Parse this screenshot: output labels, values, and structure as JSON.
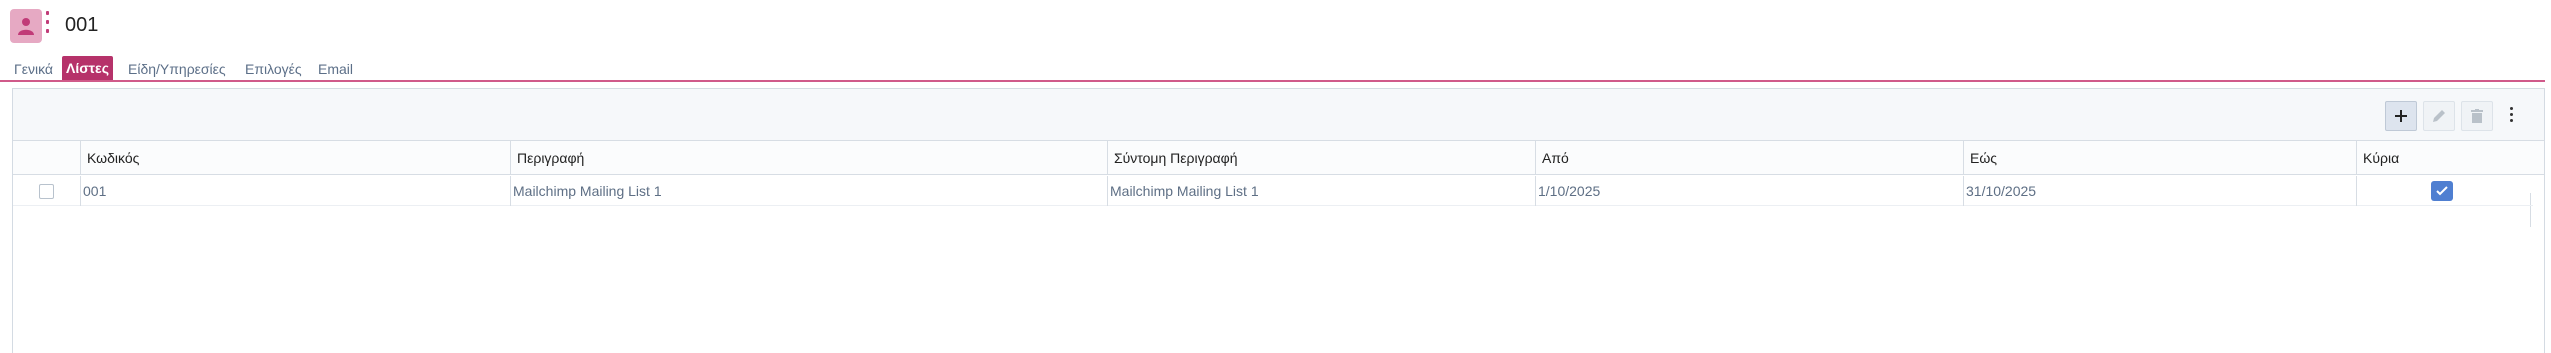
{
  "record": {
    "title": "001"
  },
  "tabs": [
    {
      "label": "Γενικά"
    },
    {
      "label": "Λίστες",
      "active": true
    },
    {
      "label": "Είδη/Υπηρεσίες"
    },
    {
      "label": "Επιλογές"
    },
    {
      "label": "Email"
    }
  ],
  "toolbar": {
    "add_icon": "plus-icon",
    "edit_icon": "pencil-icon",
    "delete_icon": "trash-icon",
    "more_icon": "kebab-icon"
  },
  "table": {
    "columns": [
      "Κωδικός",
      "Περιγραφή",
      "Σύντομη Περιγραφή",
      "Από",
      "Εώς",
      "Κύρια"
    ],
    "rows": [
      {
        "code": "001",
        "description": "Mailchimp Mailing List 1",
        "short_description": "Mailchimp Mailing List 1",
        "from": "1/10/2025",
        "to": "31/10/2025",
        "main": true
      }
    ]
  },
  "colors": {
    "accent": "#b6326a",
    "checkbox_checked": "#4f7fd1",
    "avatar_bg": "#e6a9c3"
  }
}
